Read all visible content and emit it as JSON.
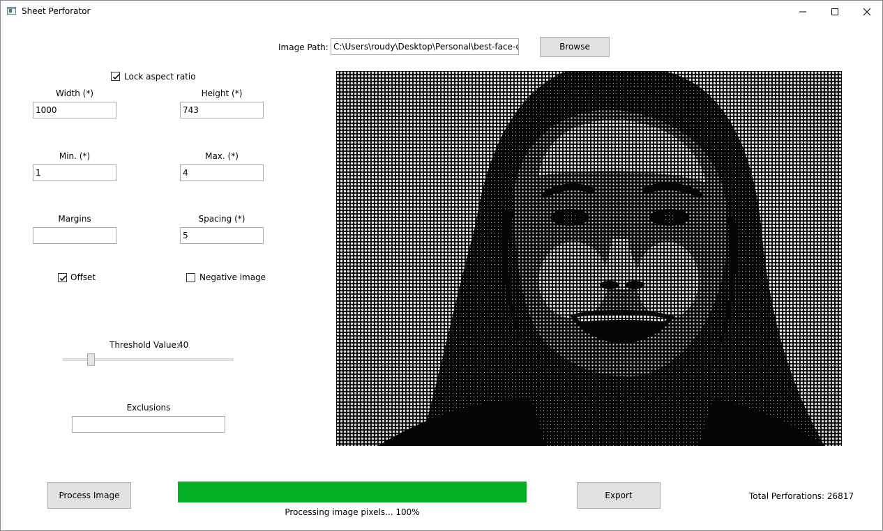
{
  "window": {
    "title": "Sheet Perforator"
  },
  "image_path": {
    "label": "Image Path:",
    "value": "C:\\Users\\roudy\\Desktop\\Personal\\best-face-oil.png",
    "browse_label": "Browse"
  },
  "settings": {
    "lock_aspect_ratio": {
      "label": "Lock aspect ratio",
      "checked": true
    },
    "width": {
      "label": "Width (*)",
      "value": "1000"
    },
    "height": {
      "label": "Height (*)",
      "value": "743"
    },
    "min": {
      "label": "Min. (*)",
      "value": "1"
    },
    "max": {
      "label": "Max. (*)",
      "value": "4"
    },
    "margins": {
      "label": "Margins",
      "value": ""
    },
    "spacing": {
      "label": "Spacing (*)",
      "value": "5"
    },
    "offset": {
      "label": "Offset",
      "checked": true
    },
    "negative_image": {
      "label": "Negative image",
      "checked": false
    },
    "threshold": {
      "label": "Threshold Value:",
      "value": "40",
      "slider_fraction": 0.15
    },
    "exclusions": {
      "label": "Exclusions",
      "value": ""
    }
  },
  "preview": {
    "description_icon": "perforated-portrait-image"
  },
  "actions": {
    "process_label": "Process Image",
    "export_label": "Export"
  },
  "progress": {
    "percent": 100,
    "status": "Processing image pixels... 100%",
    "color": "#06b025"
  },
  "stats": {
    "total_perforations": "Total Perforations: 26817"
  }
}
